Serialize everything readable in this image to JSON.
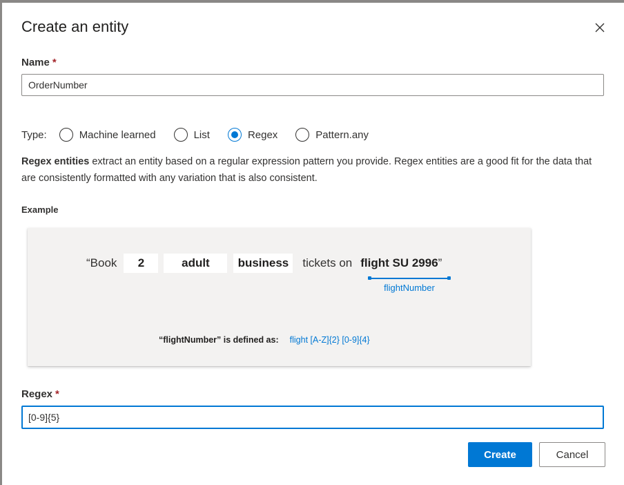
{
  "dialog": {
    "title": "Create an entity",
    "close_icon": "close-icon"
  },
  "name_field": {
    "label": "Name",
    "required_mark": "*",
    "value": "OrderNumber"
  },
  "type": {
    "label": "Type:",
    "options": [
      {
        "label": "Machine learned",
        "checked": false
      },
      {
        "label": "List",
        "checked": false
      },
      {
        "label": "Regex",
        "checked": true
      },
      {
        "label": "Pattern.any",
        "checked": false
      }
    ]
  },
  "description": {
    "bold": "Regex entities",
    "text": " extract an entity based on a regular expression pattern you provide. Regex entities are a good fit for the data that are consistently formatted with any variation that is also consistent."
  },
  "example": {
    "label": "Example",
    "open_quote": "“Book",
    "chips": [
      "2",
      "adult",
      "business"
    ],
    "plain": "tickets on",
    "entity_text": "flight SU 2996",
    "close_quote": "”",
    "entity_name": "flightNumber",
    "defined_as_text": "“flightNumber” is defined as:",
    "defined_as_value": "flight [A-Z]{2} [0-9]{4}"
  },
  "regex_field": {
    "label": "Regex",
    "required_mark": "*",
    "value": "[0-9]{5}"
  },
  "buttons": {
    "create": "Create",
    "cancel": "Cancel"
  },
  "colors": {
    "accent": "#0078d4",
    "required": "#a4262c",
    "example_bg": "#f3f2f1"
  }
}
